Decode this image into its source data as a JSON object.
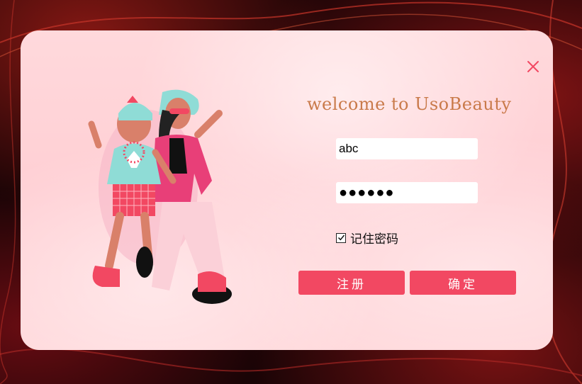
{
  "login": {
    "title": "welcome to UsoBeauty",
    "username_value": "abc",
    "password_value": "●●●●●●",
    "remember_label": "记住密码",
    "remember_checked": true,
    "register_label": "注册",
    "confirm_label": "确定"
  },
  "icons": {
    "close": "close-icon",
    "checkbox": "checkbox-checked-icon"
  },
  "colors": {
    "accent": "#f24862",
    "title": "#c97a4a",
    "close": "#f24862",
    "card_bg": "#ffd6d9"
  }
}
